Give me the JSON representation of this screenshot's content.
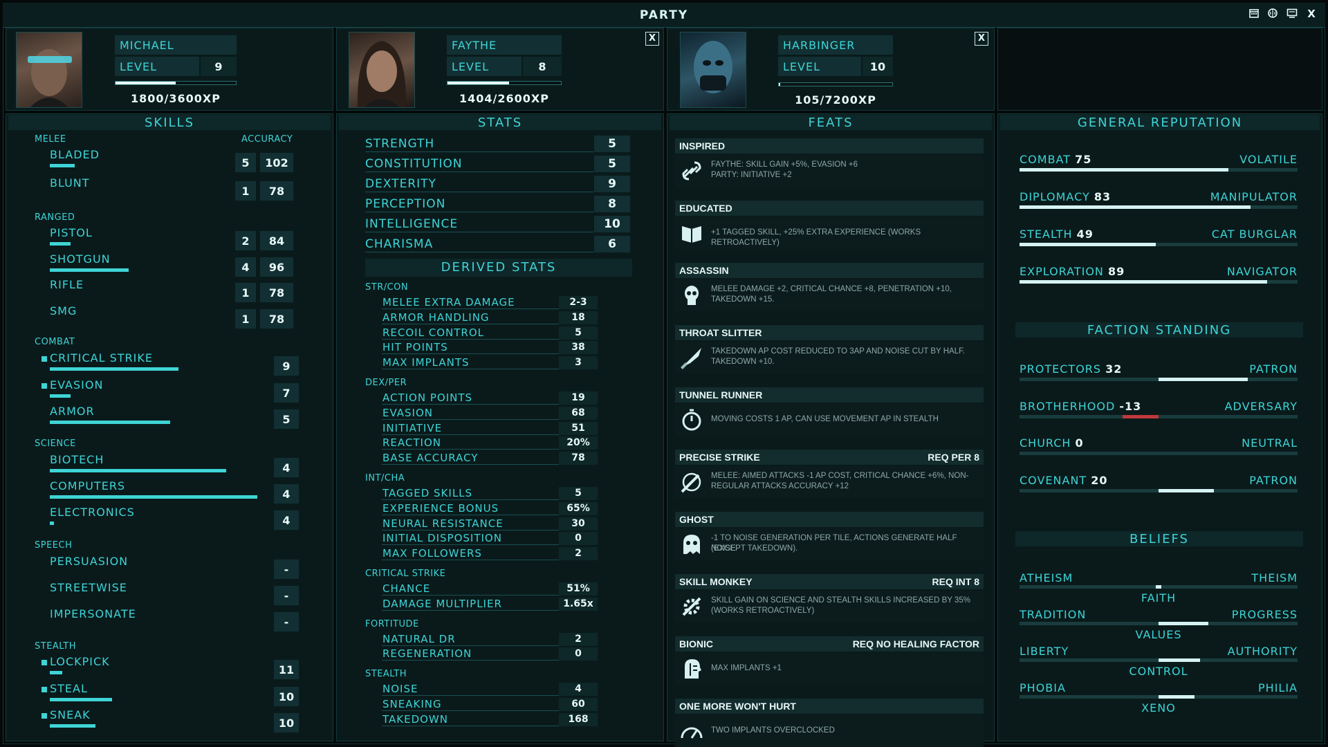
{
  "window": {
    "title": "PARTY",
    "buttons": [
      "calendar-icon",
      "brain-icon",
      "monitor-icon",
      "close-icon"
    ],
    "close_label": "X"
  },
  "party": [
    {
      "name": "MICHAEL",
      "level_label": "LEVEL",
      "level": "9",
      "xp_text": "1800/3600XP",
      "xp_fraction": 0.5,
      "closable": false
    },
    {
      "name": "FAYTHE",
      "level_label": "LEVEL",
      "level": "8",
      "xp_text": "1404/2600XP",
      "xp_fraction": 0.54,
      "closable": true,
      "close_label": "X"
    },
    {
      "name": "HARBINGER",
      "level_label": "LEVEL",
      "level": "10",
      "xp_text": "105/7200XP",
      "xp_fraction": 0.015,
      "closable": true,
      "close_label": "X"
    }
  ],
  "skills": {
    "header": "SKILLS",
    "melee_label": "MELEE",
    "accuracy_label": "ACCURACY",
    "melee": [
      {
        "name": "BLADED",
        "value": "5",
        "accuracy": "102",
        "bar": 0.12
      },
      {
        "name": "BLUNT",
        "value": "1",
        "accuracy": "78",
        "bar": 0.0
      }
    ],
    "ranged_label": "RANGED",
    "ranged": [
      {
        "name": "PISTOL",
        "value": "2",
        "accuracy": "84",
        "bar": 0.1
      },
      {
        "name": "SHOTGUN",
        "value": "4",
        "accuracy": "96",
        "bar": 0.38
      },
      {
        "name": "RIFLE",
        "value": "1",
        "accuracy": "78",
        "bar": 0.0
      },
      {
        "name": "SMG",
        "value": "1",
        "accuracy": "78",
        "bar": 0.0
      }
    ],
    "combat_label": "COMBAT",
    "combat": [
      {
        "name": "CRITICAL STRIKE",
        "value": "9",
        "bar": 0.62,
        "tagged": true
      },
      {
        "name": "EVASION",
        "value": "7",
        "bar": 0.1,
        "tagged": true
      },
      {
        "name": "ARMOR",
        "value": "5",
        "bar": 0.58,
        "tagged": false
      }
    ],
    "science_label": "SCIENCE",
    "science": [
      {
        "name": "BIOTECH",
        "value": "4",
        "bar": 0.85,
        "tagged": false
      },
      {
        "name": "COMPUTERS",
        "value": "4",
        "bar": 1.0,
        "tagged": false
      },
      {
        "name": "ELECTRONICS",
        "value": "4",
        "bar": 0.02,
        "tagged": false
      }
    ],
    "speech_label": "SPEECH",
    "speech": [
      {
        "name": "PERSUASION",
        "value": "-",
        "bar": 0,
        "tagged": false
      },
      {
        "name": "STREETWISE",
        "value": "-",
        "bar": 0,
        "tagged": false
      },
      {
        "name": "IMPERSONATE",
        "value": "-",
        "bar": 0,
        "tagged": false
      }
    ],
    "stealth_label": "STEALTH",
    "stealth": [
      {
        "name": "LOCKPICK",
        "value": "11",
        "bar": 0.06,
        "tagged": true
      },
      {
        "name": "STEAL",
        "value": "10",
        "bar": 0.3,
        "tagged": true
      },
      {
        "name": "SNEAK",
        "value": "10",
        "bar": 0.22,
        "tagged": true
      }
    ]
  },
  "stats": {
    "header": "STATS",
    "base": [
      {
        "name": "STRENGTH",
        "value": "5"
      },
      {
        "name": "CONSTITUTION",
        "value": "5"
      },
      {
        "name": "DEXTERITY",
        "value": "9"
      },
      {
        "name": "PERCEPTION",
        "value": "8"
      },
      {
        "name": "INTELLIGENCE",
        "value": "10"
      },
      {
        "name": "CHARISMA",
        "value": "6"
      }
    ],
    "derived_header": "DERIVED STATS",
    "groups": [
      {
        "label": "STR/CON",
        "rows": [
          {
            "name": "MELEE EXTRA DAMAGE",
            "value": "2-3"
          },
          {
            "name": "ARMOR HANDLING",
            "value": "18"
          },
          {
            "name": "RECOIL CONTROL",
            "value": "5"
          },
          {
            "name": "HIT POINTS",
            "value": "38"
          },
          {
            "name": "MAX IMPLANTS",
            "value": "3"
          }
        ]
      },
      {
        "label": "DEX/PER",
        "rows": [
          {
            "name": "ACTION POINTS",
            "value": "19"
          },
          {
            "name": "EVASION",
            "value": "68"
          },
          {
            "name": "INITIATIVE",
            "value": "51"
          },
          {
            "name": "REACTION",
            "value": "20%"
          },
          {
            "name": "BASE ACCURACY",
            "value": "78"
          }
        ]
      },
      {
        "label": "INT/CHA",
        "rows": [
          {
            "name": "TAGGED SKILLS",
            "value": "5"
          },
          {
            "name": "EXPERIENCE BONUS",
            "value": "65%"
          },
          {
            "name": "NEURAL RESISTANCE",
            "value": "30"
          },
          {
            "name": "INITIAL DISPOSITION",
            "value": "0"
          },
          {
            "name": "MAX FOLLOWERS",
            "value": "2"
          }
        ]
      },
      {
        "label": "CRITICAL STRIKE",
        "rows": [
          {
            "name": "CHANCE",
            "value": "51%"
          },
          {
            "name": "DAMAGE MULTIPLIER",
            "value": "1.65x"
          }
        ]
      },
      {
        "label": "FORTITUDE",
        "rows": [
          {
            "name": "NATURAL DR",
            "value": "2"
          },
          {
            "name": "REGENERATION",
            "value": "0"
          }
        ]
      },
      {
        "label": "STEALTH",
        "rows": [
          {
            "name": "NOISE",
            "value": "4"
          },
          {
            "name": "SNEAKING",
            "value": "60"
          },
          {
            "name": "TAKEDOWN",
            "value": "168"
          }
        ]
      }
    ]
  },
  "feats": {
    "header": "FEATS",
    "items": [
      {
        "name": "INSPIRED",
        "req": "",
        "icon": "chain-link-icon",
        "desc": [
          "FAYTHE: SKILL GAIN +5%, EVASION +6",
          "PARTY: INITIATIVE +2"
        ]
      },
      {
        "name": "EDUCATED",
        "req": "",
        "icon": "book-icon",
        "desc": [
          "+1 TAGGED SKILL, +25% EXTRA EXPERIENCE (WORKS RETROACTIVELY)"
        ]
      },
      {
        "name": "ASSASSIN",
        "req": "",
        "icon": "skull-icon",
        "desc": [
          "MELEE DAMAGE +2, CRITICAL CHANCE +8, PENETRATION +10,",
          "TAKEDOWN +15."
        ]
      },
      {
        "name": "THROAT SLITTER",
        "req": "",
        "icon": "knife-icon",
        "desc": [
          "TAKEDOWN AP COST REDUCED TO 3AP AND NOISE CUT BY HALF.",
          "TAKEDOWN +10."
        ]
      },
      {
        "name": "TUNNEL RUNNER",
        "req": "",
        "icon": "stopwatch-icon",
        "desc": [
          "MOVING COSTS 1 AP, CAN USE MOVEMENT AP IN STEALTH"
        ]
      },
      {
        "name": "PRECISE STRIKE",
        "req": "REQ PER 8",
        "icon": "crosshair-strike-icon",
        "desc": [
          "MELEE: AIMED ATTACKS -1 AP COST, CRITICAL CHANCE +6%, NON-",
          "REGULAR ATTACKS ACCURACY +12"
        ]
      },
      {
        "name": "GHOST",
        "req": "",
        "icon": "ghost-icon",
        "desc": [
          "-1 TO NOISE GENERATION PER TILE, ACTIONS GENERATE HALF NOISE",
          "(EXCEPT TAKEDOWN)."
        ]
      },
      {
        "name": "SKILL MONKEY",
        "req": "REQ INT 8",
        "icon": "gear-wrench-icon",
        "desc": [
          "SKILL GAIN ON SCIENCE AND STEALTH SKILLS INCREASED BY 35%",
          "(WORKS RETROACTIVELY)"
        ]
      },
      {
        "name": "BIONIC",
        "req": "REQ NO HEALING FACTOR",
        "icon": "bionic-head-icon",
        "desc": [
          "MAX IMPLANTS +1"
        ]
      },
      {
        "name": "ONE MORE WON'T HURT",
        "req": "",
        "icon": "gauge-icon",
        "desc": [
          "TWO IMPLANTS OVERCLOCKED"
        ]
      }
    ]
  },
  "reputation": {
    "header": "GENERAL REPUTATION",
    "items": [
      {
        "name": "COMBAT",
        "value": "75",
        "title": "VOLATILE",
        "fill": 0.75
      },
      {
        "name": "DIPLOMACY",
        "value": "83",
        "title": "MANIPULATOR",
        "fill": 0.83
      },
      {
        "name": "STEALTH",
        "value": "49",
        "title": "CAT BURGLAR",
        "fill": 0.49
      },
      {
        "name": "EXPLORATION",
        "value": "89",
        "title": "NAVIGATOR",
        "fill": 0.89
      }
    ]
  },
  "factions": {
    "header": "FACTION STANDING",
    "items": [
      {
        "name": "PROTECTORS",
        "value": "32",
        "title": "PATRON",
        "level": 32
      },
      {
        "name": "BROTHERHOOD",
        "value": "-13",
        "title": "ADVERSARY",
        "level": -13
      },
      {
        "name": "CHURCH",
        "value": "0",
        "title": "NEUTRAL",
        "level": 0
      },
      {
        "name": "COVENANT",
        "value": "20",
        "title": "PATRON",
        "level": 20
      }
    ],
    "colors": {
      "positive": "#d6f2f2",
      "negative": "#c0393b"
    }
  },
  "beliefs": {
    "header": "BELIEFS",
    "items": [
      {
        "left": "ATHEISM",
        "right": "THEISM",
        "label": "FAITH",
        "from": 0.49,
        "to": 0.51
      },
      {
        "left": "TRADITION",
        "right": "PROGRESS",
        "label": "VALUES",
        "from": 0.5,
        "to": 0.68
      },
      {
        "left": "LIBERTY",
        "right": "AUTHORITY",
        "label": "CONTROL",
        "from": 0.5,
        "to": 0.65
      },
      {
        "left": "PHOBIA",
        "right": "PHILIA",
        "label": "XENO",
        "from": 0.5,
        "to": 0.63
      }
    ]
  },
  "colors": {
    "accent": "#3fd4d6",
    "panel": "#0a1a1b",
    "text_bright": "#e8f8f8"
  }
}
